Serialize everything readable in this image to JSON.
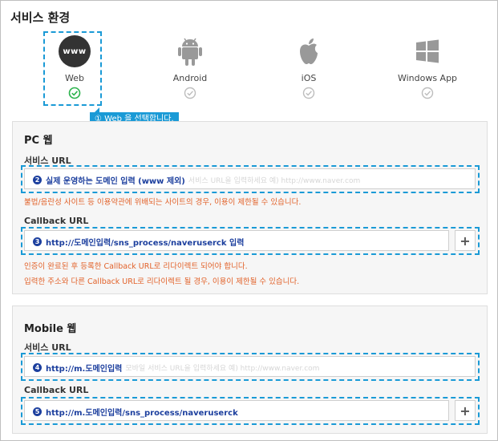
{
  "section_title": "서비스 환경",
  "environments": [
    {
      "label": "Web",
      "logo_text": "www",
      "selected": true
    },
    {
      "label": "Android",
      "selected": false
    },
    {
      "label": "iOS",
      "selected": false
    },
    {
      "label": "Windows App",
      "selected": false
    }
  ],
  "tooltip": "① Web 을 선택합니다.",
  "pc": {
    "title": "PC 웹",
    "service_url_label": "서비스 URL",
    "service_url_num": "2",
    "service_url_value": "실제 운영하는 도메인 입력 (www 제외)",
    "service_url_placeholder": "서비스 URL을 입력하세요 예) http://www.naver.com",
    "service_url_warning": "불법/음란성 사이트 등 이용약관에 위배되는 사이트의 경우, 이용이 제한될 수 있습니다.",
    "callback_url_label": "Callback URL",
    "callback_url_num": "3",
    "callback_url_value": "http://도메인입력/sns_process/naveruserck 입력",
    "callback_warning_1": "인증이 완료된 후 등록한 Callback URL로 리다이렉트 되어야 합니다.",
    "callback_warning_2": "입력한 주소와 다른 Callback URL로 리다이렉트 될 경우, 이용이 제한될 수 있습니다.",
    "plus_label": "+"
  },
  "mobile": {
    "title": "Mobile 웹",
    "service_url_label": "서비스 URL",
    "service_url_num": "4",
    "service_url_value": "http://m.도메인입력",
    "service_url_placeholder": "모바일 서비스 URL을 입력하세요 예) http://www.naver.com",
    "callback_url_label": "Callback URL",
    "callback_url_num": "5",
    "callback_url_value": "http://m.도메인입력/sns_process/naveruserck",
    "plus_label": "+"
  },
  "colors": {
    "accent": "#1a9ad6",
    "warning": "#e2622a",
    "link_text": "#1c3f9e",
    "check_green": "#2bb24c"
  }
}
